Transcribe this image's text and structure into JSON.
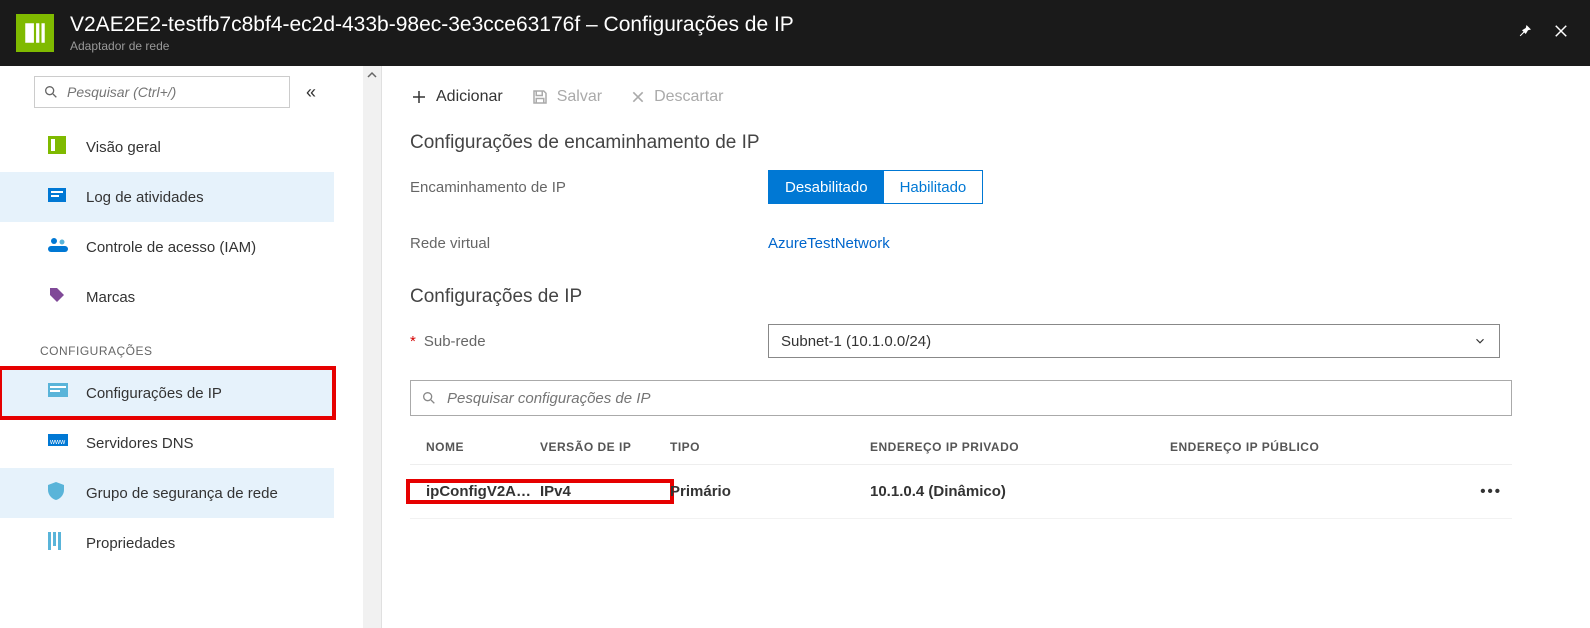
{
  "header": {
    "title": "V2AE2E2-testfb7c8bf4-ec2d-433b-98ec-3e3cce63176f – Configurações de IP",
    "subtitle": "Adaptador de rede"
  },
  "sidebar": {
    "search_placeholder": "Pesquisar (Ctrl+/)",
    "items": [
      {
        "label": "Visão geral"
      },
      {
        "label": "Log de atividades"
      },
      {
        "label": "Controle de acesso (IAM)"
      },
      {
        "label": "Marcas"
      }
    ],
    "section": "CONFIGURAÇÕES",
    "config_items": [
      {
        "label": "Configurações de IP"
      },
      {
        "label": "Servidores DNS"
      },
      {
        "label": "Grupo de segurança de rede"
      },
      {
        "label": "Propriedades"
      }
    ]
  },
  "toolbar": {
    "add": "Adicionar",
    "save": "Salvar",
    "discard": "Descartar"
  },
  "section1": {
    "title": "Configurações de encaminhamento de IP",
    "forwarding_label": "Encaminhamento de IP",
    "disabled": "Desabilitado",
    "enabled": "Habilitado",
    "vnet_label": "Rede virtual",
    "vnet_value": "AzureTestNetwork"
  },
  "section2": {
    "title": "Configurações de IP",
    "subnet_label": "Sub-rede",
    "subnet_value": "Subnet-1 (10.1.0.0/24)"
  },
  "ipconfigs": {
    "search_placeholder": "Pesquisar configurações de IP",
    "columns": {
      "name": "NOME",
      "version": "VERSÃO DE IP",
      "type": "TIPO",
      "private": "ENDEREÇO IP PRIVADO",
      "public": "ENDEREÇO IP PÚBLICO"
    },
    "rows": [
      {
        "name": "ipConfigV2A…",
        "version": "IPv4",
        "type": "Primário",
        "private": "10.1.0.4 (Dinâmico)",
        "public": ""
      }
    ],
    "more": "•••"
  }
}
